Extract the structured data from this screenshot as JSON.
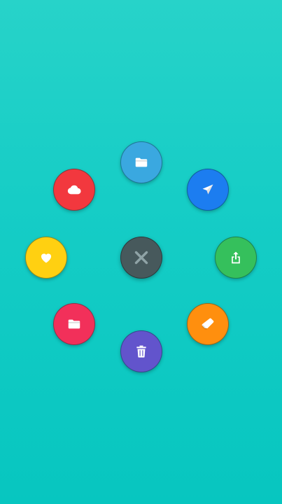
{
  "menu": {
    "center": {
      "icon": "close-icon",
      "color": "#47595c",
      "icon_color": "#8fa3a6"
    },
    "items": [
      {
        "id": "folder-top",
        "icon": "folder-icon",
        "color": "#3aa8e0"
      },
      {
        "id": "send",
        "icon": "send-icon",
        "color": "#1c7df0"
      },
      {
        "id": "share",
        "icon": "share-icon",
        "color": "#35c05c"
      },
      {
        "id": "eraser",
        "icon": "eraser-icon",
        "color": "#ff8f0e"
      },
      {
        "id": "delete",
        "icon": "delete-icon",
        "color": "#6254cc"
      },
      {
        "id": "folder-bottom",
        "icon": "folder-icon",
        "color": "#f2305a"
      },
      {
        "id": "favorite",
        "icon": "heart-icon",
        "color": "#ffd011"
      },
      {
        "id": "cloud",
        "icon": "cloud-icon",
        "color": "#f2383e"
      }
    ]
  },
  "background_color": "#12ccc5"
}
